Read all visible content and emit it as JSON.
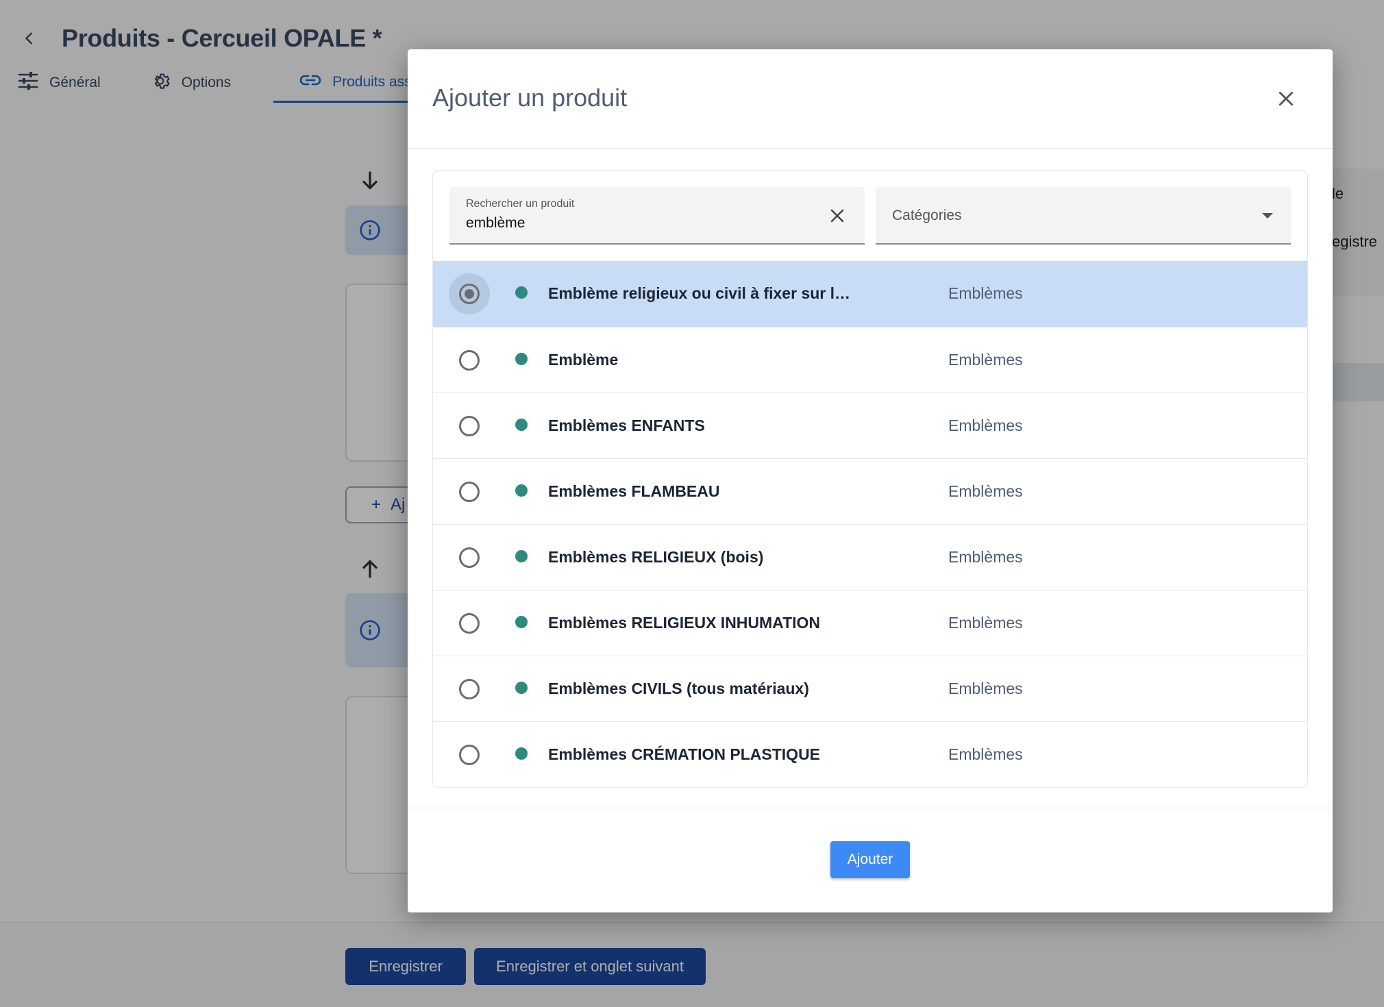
{
  "page": {
    "title": "Produits - Cercueil OPALE *",
    "tabs": [
      {
        "label": "Général",
        "icon": "sliders-icon"
      },
      {
        "label": "Options",
        "icon": "gear-icon"
      },
      {
        "label": "Produits assoc",
        "icon": "link-icon"
      }
    ],
    "add_button_label": "Aj",
    "right_panel_text_1": "le",
    "right_panel_text_2": "egistre",
    "footer": {
      "save_label": "Enregistrer",
      "save_next_label": "Enregistrer et onglet suivant"
    }
  },
  "modal": {
    "title": "Ajouter un produit",
    "search": {
      "label": "Rechercher un produit",
      "value": "emblème"
    },
    "categories": {
      "label": "Catégories"
    },
    "products": [
      {
        "name": "Emblème religieux ou civil à fixer sur le cer...",
        "category": "Emblèmes",
        "selected": true
      },
      {
        "name": "Emblème",
        "category": "Emblèmes",
        "selected": false
      },
      {
        "name": "Emblèmes ENFANTS",
        "category": "Emblèmes",
        "selected": false
      },
      {
        "name": "Emblèmes FLAMBEAU",
        "category": "Emblèmes",
        "selected": false
      },
      {
        "name": "Emblèmes RELIGIEUX (bois)",
        "category": "Emblèmes",
        "selected": false
      },
      {
        "name": "Emblèmes RELIGIEUX INHUMATION",
        "category": "Emblèmes",
        "selected": false
      },
      {
        "name": "Emblèmes CIVILS (tous matériaux)",
        "category": "Emblèmes",
        "selected": false
      },
      {
        "name": "Emblèmes CRÉMATION PLASTIQUE",
        "category": "Emblèmes",
        "selected": false
      }
    ],
    "add_label": "Ajouter"
  },
  "colors": {
    "accent": "#1d64c9",
    "primary_button": "#3d8af7",
    "dark_button": "#1d4ba0",
    "selected_row": "#c8dcf5",
    "status_dot": "#2e8a7e",
    "info_box": "#d6e5f7"
  }
}
